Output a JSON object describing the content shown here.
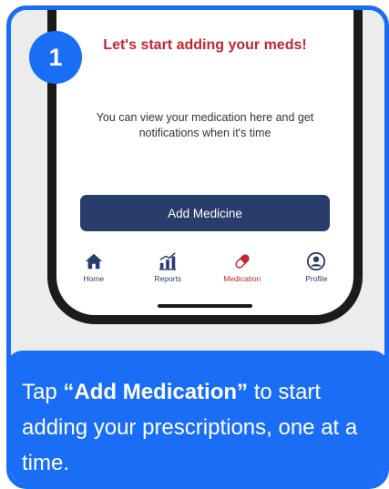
{
  "step": {
    "number": "1"
  },
  "screen": {
    "headline": "Let's start adding your meds!",
    "subtext": "You can view your medication here and get notifications when it's time",
    "add_button_label": "Add Medicine"
  },
  "tabbar": {
    "items": [
      {
        "label": "Home",
        "icon": "home-icon"
      },
      {
        "label": "Reports",
        "icon": "bar-chart-icon"
      },
      {
        "label": "Medication",
        "icon": "pill-icon",
        "active": true
      },
      {
        "label": "Profile",
        "icon": "profile-icon"
      }
    ]
  },
  "instruction": {
    "prefix": "Tap ",
    "highlight": "“Add Medication”",
    "suffix": " to start adding your prescriptions, one at a time."
  },
  "colors": {
    "accent_blue": "#1a6ef5",
    "navy": "#283d6b",
    "red": "#c0282f",
    "card_bg": "#ececec"
  }
}
